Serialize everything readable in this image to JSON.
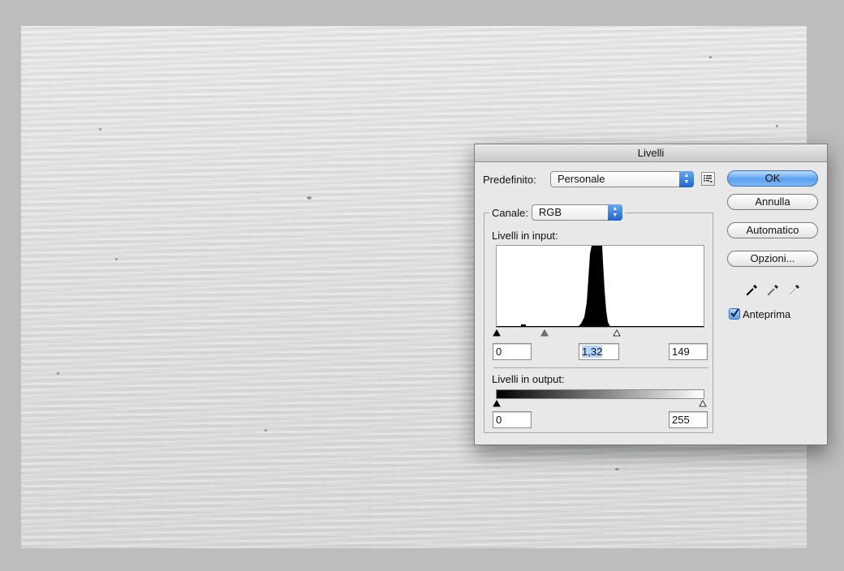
{
  "dialog": {
    "title": "Livelli",
    "preset_label": "Predefinito:",
    "preset_value": "Personale",
    "channel_label": "Canale:",
    "channel_value": "RGB",
    "input_levels_label": "Livelli in input:",
    "output_levels_label": "Livelli in output:",
    "input_black": "0",
    "input_gamma": "1,32",
    "input_white": "149",
    "output_black": "0",
    "output_white": "255",
    "buttons": {
      "ok": "OK",
      "cancel": "Annulla",
      "auto": "Automatico",
      "options": "Opzioni..."
    },
    "preview_label": "Anteprima",
    "preview_checked": true
  },
  "colors": {
    "accent_blue": "#5aa0ee",
    "selection": "#b5d5ff"
  },
  "icons": [
    "list-menu-icon",
    "black-eyedropper-icon",
    "gray-eyedropper-icon",
    "white-eyedropper-icon",
    "checkmark-icon"
  ]
}
